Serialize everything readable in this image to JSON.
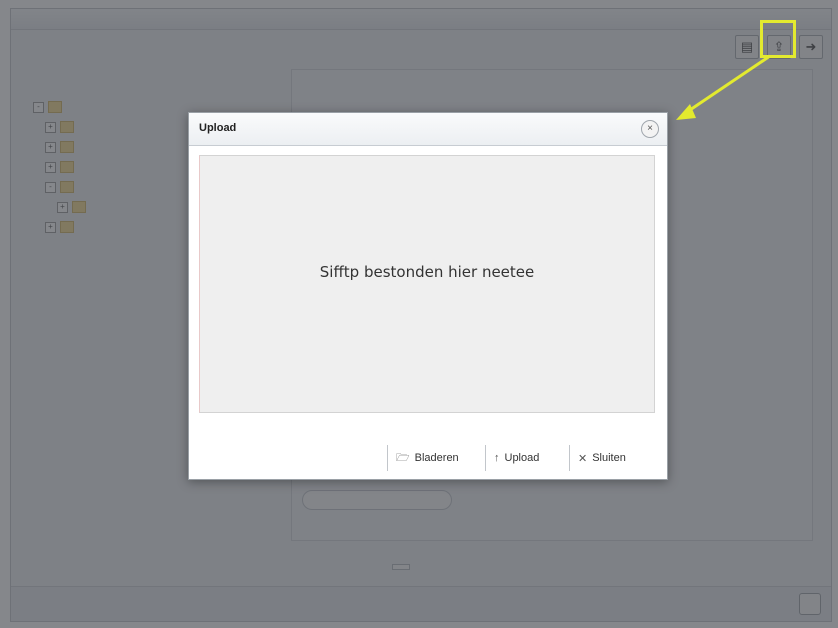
{
  "app": {
    "window_title": "",
    "menu": [
      "",
      "",
      "",
      "",
      ""
    ],
    "breadcrumbs": [
      "",
      "",
      ""
    ],
    "tree_items": [
      "",
      "",
      "",
      "",
      "",
      "",
      ""
    ],
    "canvas_selector": "",
    "pager": "",
    "bottom_button": ""
  },
  "dialog": {
    "title": "Upload",
    "close_glyph": "×",
    "dropzone_text": "Sifftp bestonden hier neetee",
    "buttons": {
      "browse": "Bladeren",
      "upload": "Upload",
      "close": "Sluiten"
    }
  },
  "colors": {
    "overlay": "#4b4e54",
    "highlight": "#e3ea2f"
  },
  "icons": {
    "browse": "folder-icon",
    "upload": "upload-arrow-icon",
    "close": "close-x-icon",
    "toolbar_highlighted": "upload-toolbar-icon"
  }
}
